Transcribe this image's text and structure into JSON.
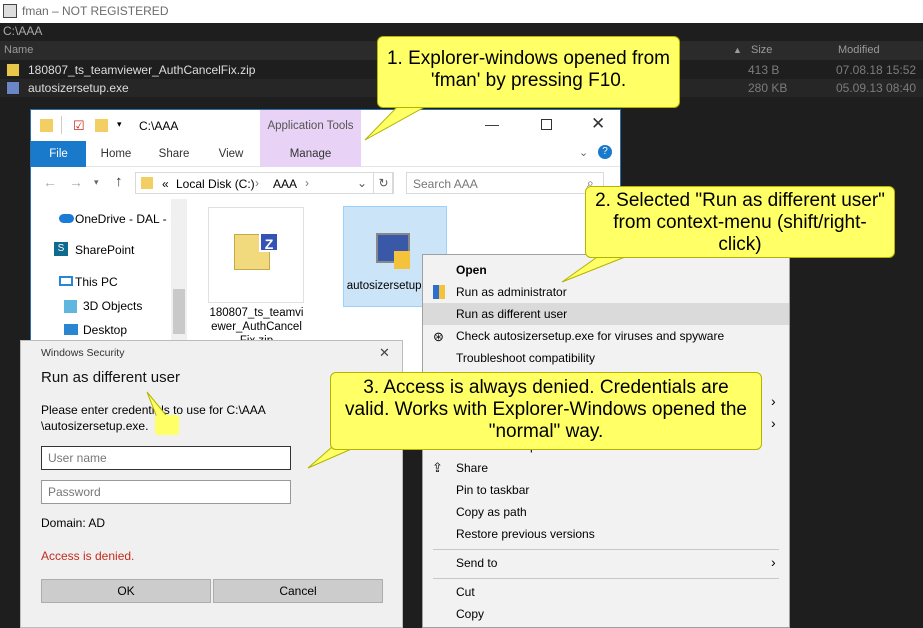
{
  "fman": {
    "title": "fman – NOT REGISTERED",
    "path": "C:\\AAA",
    "headers": {
      "name": "Name",
      "size": "Size",
      "modified": "Modified"
    },
    "rows": [
      {
        "name": "180807_ts_teamviewer_AuthCancelFix.zip",
        "size": "413 B",
        "modified": "07.08.18 15:52"
      },
      {
        "name": "autosizersetup.exe",
        "size": "280 KB",
        "modified": "05.09.13 08:40"
      }
    ]
  },
  "explorer": {
    "title": "C:\\AAA",
    "context_tab": "Application Tools",
    "tabs": {
      "file": "File",
      "home": "Home",
      "share": "Share",
      "view": "View",
      "manage": "Manage"
    },
    "breadcrumb": {
      "prefix": "«",
      "drive": "Local Disk (C:)",
      "folder": "AAA"
    },
    "search_placeholder": "Search AAA",
    "nav": {
      "onedrive": "OneDrive - DAL - ...",
      "sharepoint": "SharePoint",
      "thispc": "This PC",
      "objects3d": "3D Objects",
      "desktop": "Desktop"
    },
    "files": {
      "zip_label": "180807_ts_teamviewer_AuthCancel Fix.zip",
      "exe_label": "autosizersetup.exe"
    }
  },
  "context_menu": {
    "open": "Open",
    "run_admin": "Run as administrator",
    "run_different": "Run as different user",
    "check": "Check autosizersetup.exe for viruses and spyware",
    "troubleshoot": "Troubleshoot compatibility",
    "edit_notepad": "Edit with Notepad++",
    "share": "Share",
    "pin_taskbar": "Pin to taskbar",
    "copy_path": "Copy as path",
    "restore": "Restore previous versions",
    "send_to": "Send to",
    "cut": "Cut",
    "copy": "Copy"
  },
  "dialog": {
    "window_title": "Windows Security",
    "heading": "Run as different user",
    "message_line1": "Please enter credentials to use for C:\\AAA",
    "message_line2": "\\autosizersetup.exe.",
    "username_placeholder": "User name",
    "password_placeholder": "Password",
    "domain": "Domain: AD",
    "error": "Access is denied.",
    "ok": "OK",
    "cancel": "Cancel"
  },
  "callouts": {
    "c1": "1. Explorer-windows opened from 'fman' by pressing F10.",
    "c2": "2. Selected \"Run as different user\" from context-menu (shift/right-click)",
    "c3": "3. Access is always denied. Credentials are valid. Works with Explorer-Windows opened the \"normal\" way."
  },
  "colors": {
    "callout": "#ffff66",
    "accent": "#1979ca",
    "error": "#c42b1c",
    "context_tab": "#e8d2f5"
  }
}
